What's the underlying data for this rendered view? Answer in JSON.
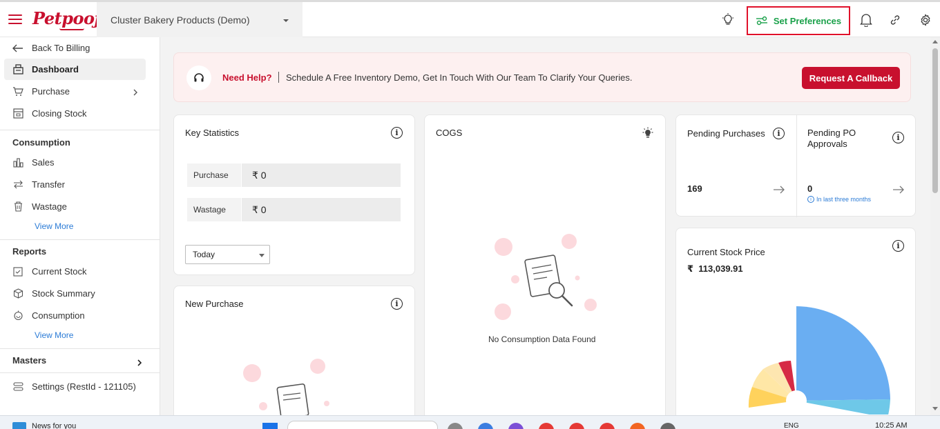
{
  "header": {
    "logo": "Petpooja",
    "outlet": "Cluster Bakery Products (Demo)",
    "set_preferences": "Set Preferences"
  },
  "sidebar": {
    "back": "Back To Billing",
    "dashboard": "Dashboard",
    "purchase": "Purchase",
    "closing_stock": "Closing Stock",
    "consumption_title": "Consumption",
    "sales": "Sales",
    "transfer": "Transfer",
    "wastage": "Wastage",
    "view_more_1": "View More",
    "reports_title": "Reports",
    "current_stock": "Current Stock",
    "stock_summary": "Stock Summary",
    "consumption": "Consumption",
    "view_more_2": "View More",
    "masters": "Masters",
    "settings": "Settings (RestId - 121105)"
  },
  "banner": {
    "title": "Need Help?",
    "text": "Schedule A Free Inventory Demo, Get In Touch With Our Team To Clarify Your Queries.",
    "button": "Request A Callback"
  },
  "key_stats": {
    "title": "Key Statistics",
    "purchase_label": "Purchase",
    "purchase_value": "₹ 0",
    "wastage_label": "Wastage",
    "wastage_value": "₹ 0",
    "range": "Today"
  },
  "cogs": {
    "title": "COGS",
    "empty": "No Consumption Data Found"
  },
  "new_purchase": {
    "title": "New Purchase"
  },
  "pending": {
    "purchases_title": "Pending Purchases",
    "purchases_value": "169",
    "po_title": "Pending PO Approvals",
    "po_value": "0",
    "po_note": "In last three months"
  },
  "stock_price": {
    "title": "Current Stock Price",
    "value": "₹  113,039.91"
  },
  "taskbar": {
    "news": "News for you",
    "lang": "ENG",
    "time": "10:25 AM"
  },
  "colors": {
    "brand": "#c8102e",
    "accent_green": "#1aa14a",
    "link": "#2b7bd6"
  }
}
